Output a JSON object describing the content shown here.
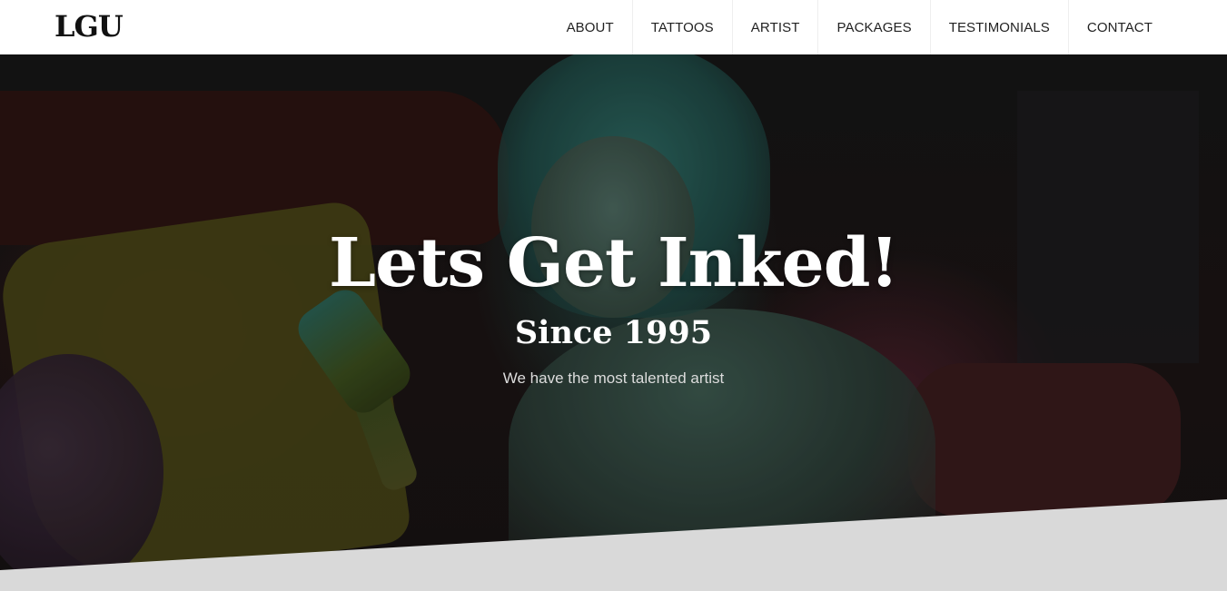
{
  "header": {
    "logo": "LGU",
    "nav": [
      {
        "label": "ABOUT"
      },
      {
        "label": "TATTOOS"
      },
      {
        "label": "ARTIST"
      },
      {
        "label": "PACKAGES"
      },
      {
        "label": "TESTIMONIALS"
      },
      {
        "label": "CONTACT"
      }
    ]
  },
  "hero": {
    "title": "Lets Get Inked!",
    "subtitle": "Since 1995",
    "tagline": "We have the most talented artist"
  },
  "colors": {
    "nav_background": "#ffffff",
    "hero_text": "#ffffff",
    "divider": "#d9d9d9"
  }
}
